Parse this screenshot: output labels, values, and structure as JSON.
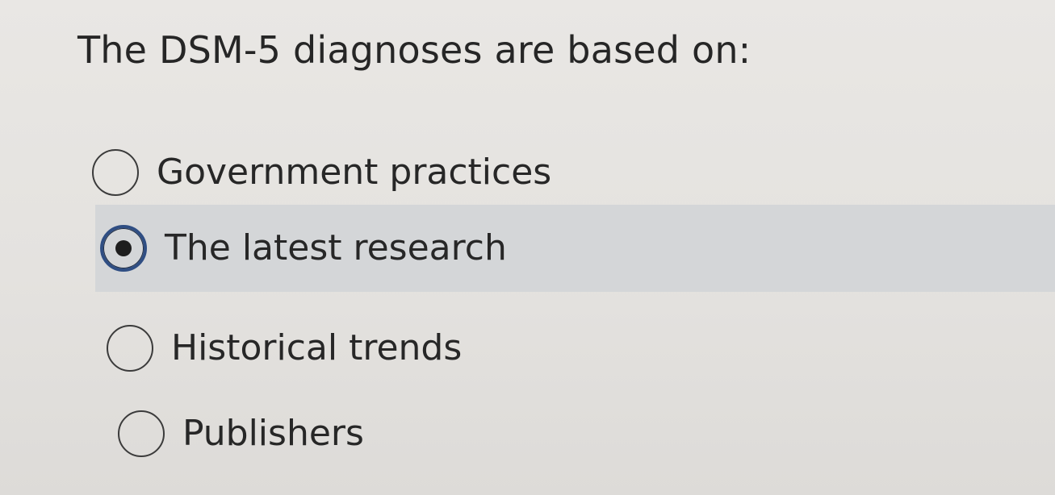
{
  "question": {
    "text": "The DSM-5 diagnoses are based on:"
  },
  "options": [
    {
      "label": "Government practices",
      "selected": false
    },
    {
      "label": "The latest research",
      "selected": true
    },
    {
      "label": "Historical trends",
      "selected": false
    },
    {
      "label": "Publishers",
      "selected": false
    }
  ],
  "colors": {
    "background": "#e6e4e1",
    "selected_row": "#d4d6d8",
    "selected_ring": "#2f4e83",
    "text": "#272727"
  }
}
